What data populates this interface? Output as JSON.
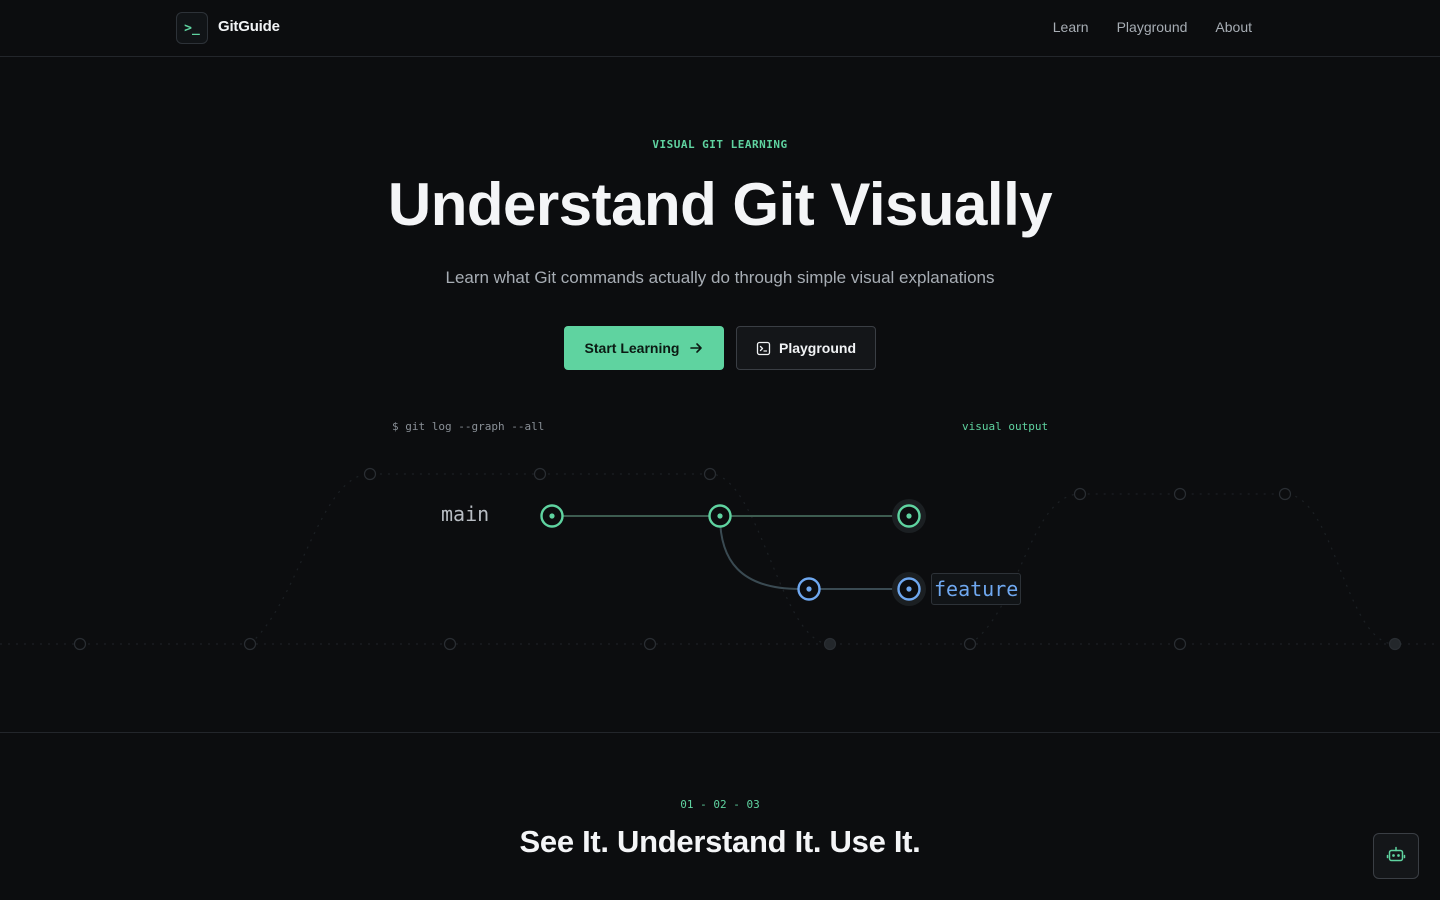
{
  "header": {
    "logo_glyph": ">_",
    "brand": "GitGuide",
    "nav": [
      {
        "label": "Learn"
      },
      {
        "label": "Playground"
      },
      {
        "label": "About"
      }
    ]
  },
  "hero": {
    "eyebrow": "VISUAL GIT LEARNING",
    "title": "Understand Git Visually",
    "subtitle": "Learn what Git commands actually do through simple visual explanations",
    "primary_button": {
      "label": "Start Learning",
      "icon": "arrow-right-icon"
    },
    "secondary_button": {
      "label": "Playground",
      "icon": "terminal-icon"
    }
  },
  "demo": {
    "command": "$ git log --graph --all",
    "output_label": "visual output",
    "branches": {
      "main": {
        "label": "main",
        "commits": 3,
        "color": "#5fd3a0"
      },
      "feature": {
        "label": "feature",
        "commits": 2,
        "color": "#6fa8f0"
      }
    }
  },
  "features": {
    "steps": "01 - 02 - 03",
    "title": "See It. Understand It. Use It."
  },
  "chat_button": {
    "icon": "bot-icon"
  },
  "colors": {
    "accent": "#5fd3a0",
    "feature_branch": "#6fa8f0",
    "background": "#0c0d0f"
  }
}
